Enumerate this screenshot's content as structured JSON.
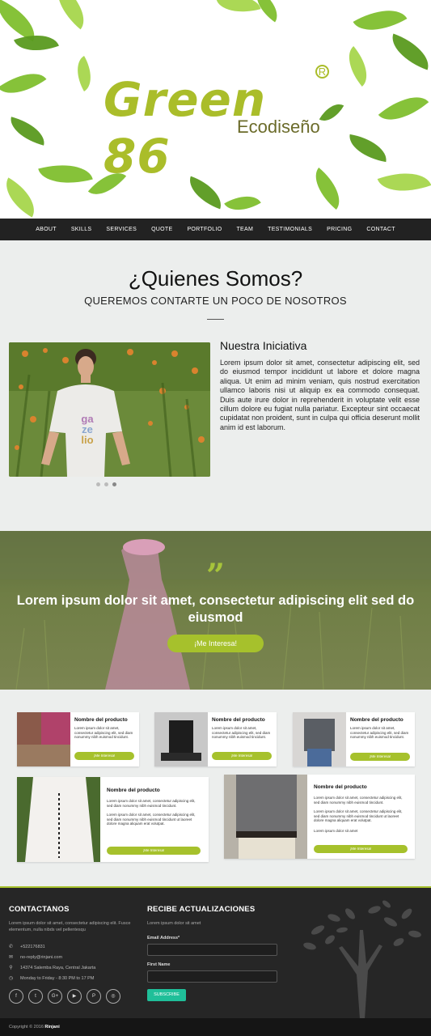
{
  "brand": {
    "name": "Green 86",
    "tagline": "Ecodiseño",
    "mark": "R"
  },
  "nav": [
    "ABOUT",
    "SKILLS",
    "SERVICES",
    "QUOTE",
    "PORTFOLIO",
    "TEAM",
    "TESTIMONIALS",
    "PRICING",
    "CONTACT"
  ],
  "about": {
    "title": "¿Quienes Somos?",
    "subtitle": "QUEREMOS CONTARTE UN POCO DE NOSOTROS",
    "heading": "Nuestra Iniciativa",
    "text": "Lorem ipsum dolor sit amet, consectetur adipiscing elit, sed do eiusmod tempor incididunt ut labore et dolore magna aliqua. Ut enim ad minim veniam, quis nostrud exercitation ullamco laboris nisi ut aliquip ex ea commodo consequat. Duis aute irure dolor in reprehenderit in voluptate velit esse cillum dolore eu fugiat nulla pariatur. Excepteur sint occaecat cupidatat non proident, sunt in culpa qui officia deserunt mollit anim id est laborum.",
    "shirt_text": [
      "ga",
      "ze",
      "lio"
    ]
  },
  "quote": {
    "mark": "”",
    "text": "Lorem ipsum dolor sit amet, consectetur adipiscing elit sed do eiusmod",
    "button": "¡Me Interesa!"
  },
  "products": [
    {
      "name": "Nombre del producto",
      "desc": "Lorem ipsum dolor sit amet, consectetur adipiscing elit, sed diam nonummy nibh euismod tincidunt.",
      "button": "¡Me Interesa!"
    },
    {
      "name": "Nombre del producto",
      "desc": "Lorem ipsum dolor sit amet, consectetur adipiscing elit, sed diam nonummy nibh euismod tincidunt.",
      "button": "¡Me Interesa!"
    },
    {
      "name": "Nombre del producto",
      "desc": "Lorem ipsum dolor sit amet, consectetur adipiscing elit, sed diam nonummy nibh euismod tincidunt.",
      "button": "¡Me Interesa!"
    },
    {
      "name": "Nombre del producto",
      "desc": "Lorem ipsum dolor sit amet, consectetur adipiscing elit, sed diam nonummy nibh euismod tincidunt.",
      "desc2": "Lorem ipsum dolor sit amet, consectetur adipiscing elit, sed diam nonummy nibh euismod tincidunt ut laoreet dolore magna aliquam erat volutpat.",
      "button": "¡Me Interesa!"
    },
    {
      "name": "Nombre del producto",
      "desc": "Lorem ipsum dolor sit amet, consectetur adipiscing elit, sed diam nonummy nibh euismod tincidunt.",
      "desc2": "Lorem ipsum dolor sit amet, consectetur adipiscing elit, sed diam nonummy nibh euismod tincidunt ut laoreet dolore magna aliquam erat volutpat.",
      "desc3": "Lorem ipsum dolor sit amet",
      "button": "¡Me Interesa!"
    }
  ],
  "footer": {
    "contact_title": "CONTACTANOS",
    "contact_text": "Lorem ipsum dolor sit amet, consectetur adipiscing elit. Fusce elementum, nulla nibds vel pellentesqu",
    "phone": "+522176831",
    "email": "no-reply@rinjani.com",
    "address": "14374 Salemba Raya, Central Jakarta",
    "hours": "Monday to Friday - 8:30 PM to 17 PM",
    "newsletter_title": "RECIBE ACTUALIZACIONES",
    "newsletter_text": "Lorem ipsum dolor sit amet",
    "email_label": "Email Address*",
    "name_label": "First Name",
    "subscribe": "SUBSCRIBE",
    "social": [
      "f",
      "t",
      "G+",
      "▶",
      "P",
      "◎"
    ]
  },
  "copyright": {
    "text": "Copyright © 2016",
    "owner": "Rinjani"
  },
  "colors": {
    "accent": "#a6c12c",
    "nav": "#222222",
    "footer": "#262626",
    "subscribe": "#1fbf99"
  }
}
